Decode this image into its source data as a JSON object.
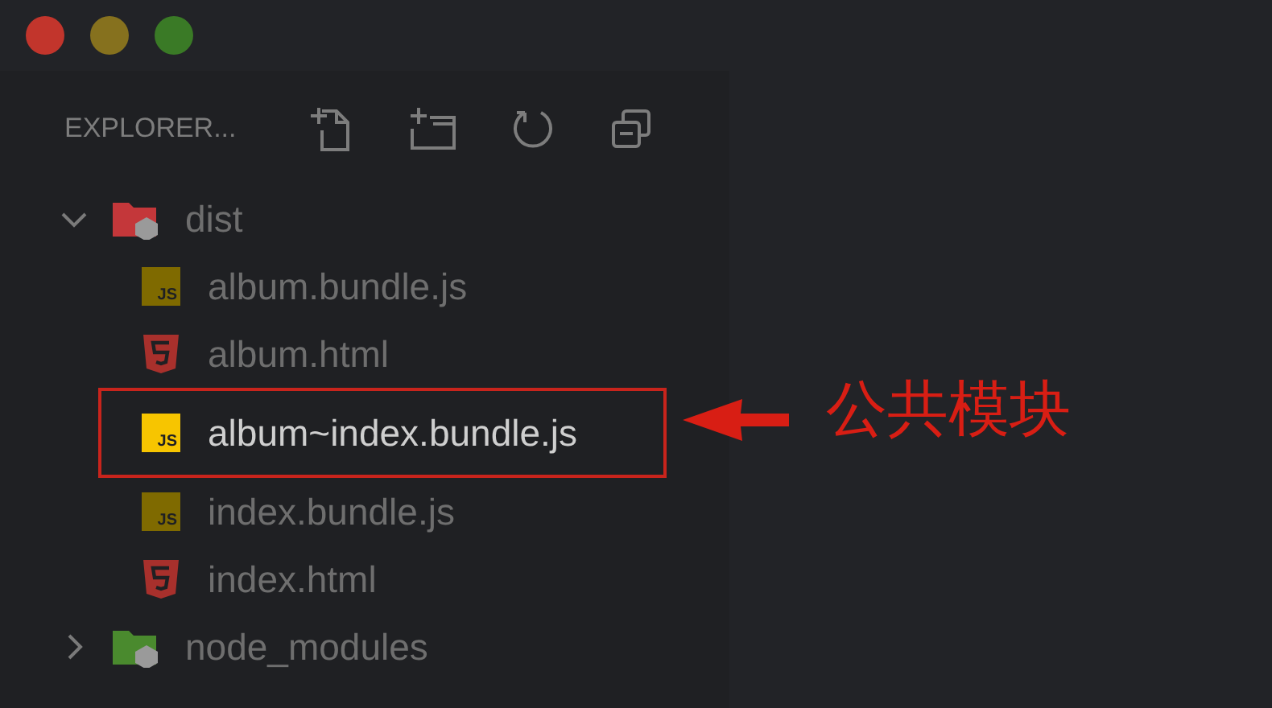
{
  "window": {
    "controls": [
      {
        "color": "#c2352c"
      },
      {
        "color": "#86711e"
      },
      {
        "color": "#3a7a26"
      }
    ]
  },
  "explorer": {
    "title": "EXPLORER...",
    "tree": [
      {
        "name": "dist",
        "kind": "folder",
        "color": "#c4373a",
        "expanded": true,
        "children": [
          {
            "name": "album.bundle.js",
            "kind": "js",
            "badge": "JS",
            "selected": false
          },
          {
            "name": "album.html",
            "kind": "html",
            "selected": false
          },
          {
            "name": "album~index.bundle.js",
            "kind": "js",
            "badge": "JS",
            "selected": true
          },
          {
            "name": "index.bundle.js",
            "kind": "js",
            "badge": "JS",
            "selected": false
          },
          {
            "name": "index.html",
            "kind": "html",
            "selected": false
          }
        ]
      },
      {
        "name": "node_modules",
        "kind": "folder",
        "color": "#4a8a2e",
        "expanded": false
      }
    ]
  },
  "annotation": {
    "label": "公共模块"
  }
}
